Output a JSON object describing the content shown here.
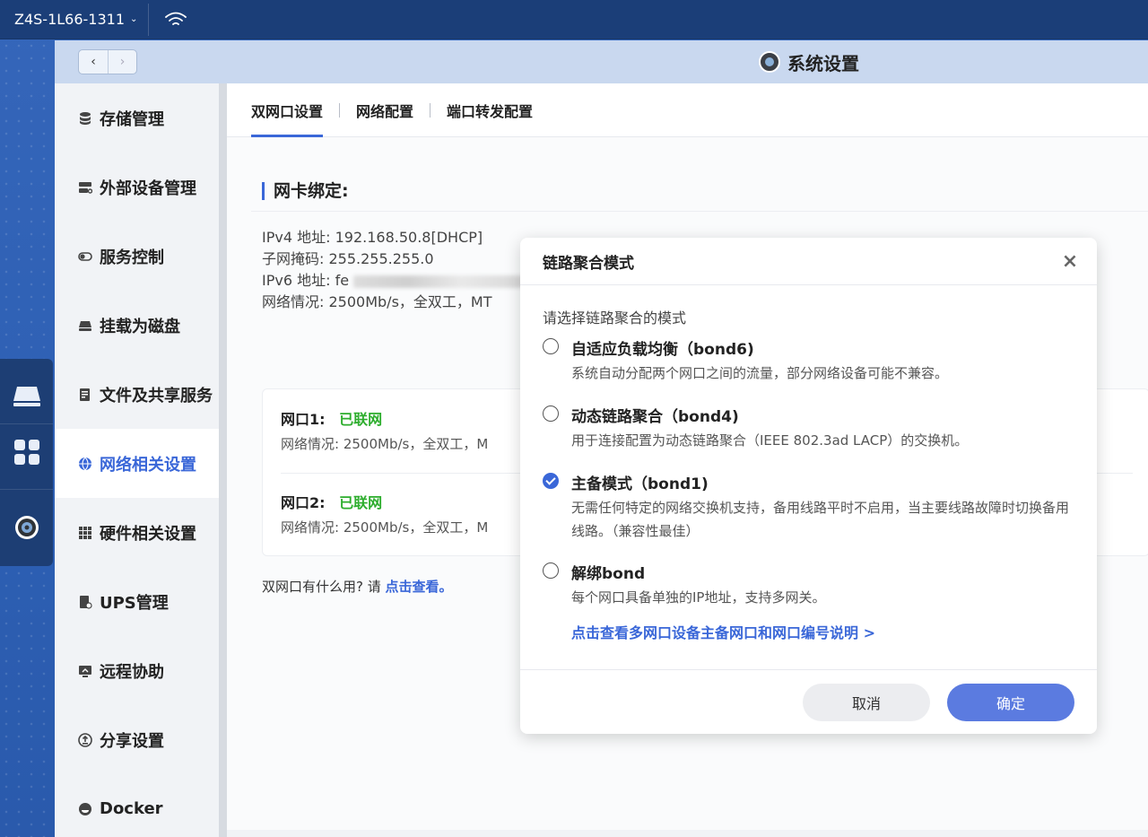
{
  "topbar": {
    "device_name": "Z4S-1L66-1311",
    "chevron": "⌄"
  },
  "window": {
    "title": "系统设置",
    "nav_back": "‹",
    "nav_forward": "›"
  },
  "sidebar": {
    "items": [
      {
        "label": "存储管理",
        "icon": "database-icon"
      },
      {
        "label": "外部设备管理",
        "icon": "devices-icon"
      },
      {
        "label": "服务控制",
        "icon": "toggle-icon"
      },
      {
        "label": "挂载为磁盘",
        "icon": "drive-icon"
      },
      {
        "label": "文件及共享服务",
        "icon": "file-share-icon"
      },
      {
        "label": "网络相关设置",
        "icon": "globe-icon",
        "active": true
      },
      {
        "label": "硬件相关设置",
        "icon": "grid-icon"
      },
      {
        "label": "UPS管理",
        "icon": "ups-icon"
      },
      {
        "label": "远程协助",
        "icon": "remote-icon"
      },
      {
        "label": "分享设置",
        "icon": "share-icon"
      },
      {
        "label": "Docker",
        "icon": "docker-icon"
      }
    ]
  },
  "tabs": [
    {
      "label": "双网口设置",
      "active": true
    },
    {
      "label": "网络配置"
    },
    {
      "label": "端口转发配置"
    }
  ],
  "bonding": {
    "section_title": "网卡绑定:",
    "ipv4_label": "IPv4 地址:",
    "ipv4_value": "192.168.50.8[DHCP]",
    "mask_label": "子网掩码:",
    "mask_value": "255.255.255.0",
    "ipv6_label": "IPv6 地址:",
    "ipv6_value": "fe",
    "net_label": "网络情况:",
    "net_value": "2500Mb/s，全双工，MT"
  },
  "ports": [
    {
      "name": "网口1:",
      "status": "已联网",
      "detail_label": "网络情况:",
      "detail_value": "2500Mb/s，全双工，M"
    },
    {
      "name": "网口2:",
      "status": "已联网",
      "detail_label": "网络情况:",
      "detail_value": "2500Mb/s，全双工，M"
    }
  ],
  "help": {
    "text": "双网口有什么用? 请",
    "link": "点击查看。"
  },
  "modal": {
    "title": "链路聚合模式",
    "close": "×",
    "prompt": "请选择链路聚合的模式",
    "options": [
      {
        "title": "自适应负载均衡（bond6)",
        "desc": "系统自动分配两个网口之间的流量，部分网络设备可能不兼容。",
        "checked": false
      },
      {
        "title": "动态链路聚合（bond4)",
        "desc": "用于连接配置为动态链路聚合（IEEE 802.3ad LACP）的交换机。",
        "checked": false
      },
      {
        "title": "主备模式（bond1)",
        "desc": "无需任何特定的网络交换机支持，备用线路平时不启用，当主要线路故障时切换备用线路。（兼容性最佳）",
        "checked": true
      },
      {
        "title": "解绑bond",
        "desc": "每个网口具备单独的IP地址，支持多网关。",
        "checked": false
      }
    ],
    "link": "点击查看多网口设备主备网口和网口编号说明 >",
    "cancel_label": "取消",
    "ok_label": "确定"
  },
  "colors": {
    "accent": "#3a67d8",
    "online": "#2dad2d",
    "topbar": "#1b3e78",
    "titlebar": "#c9d8ef"
  }
}
